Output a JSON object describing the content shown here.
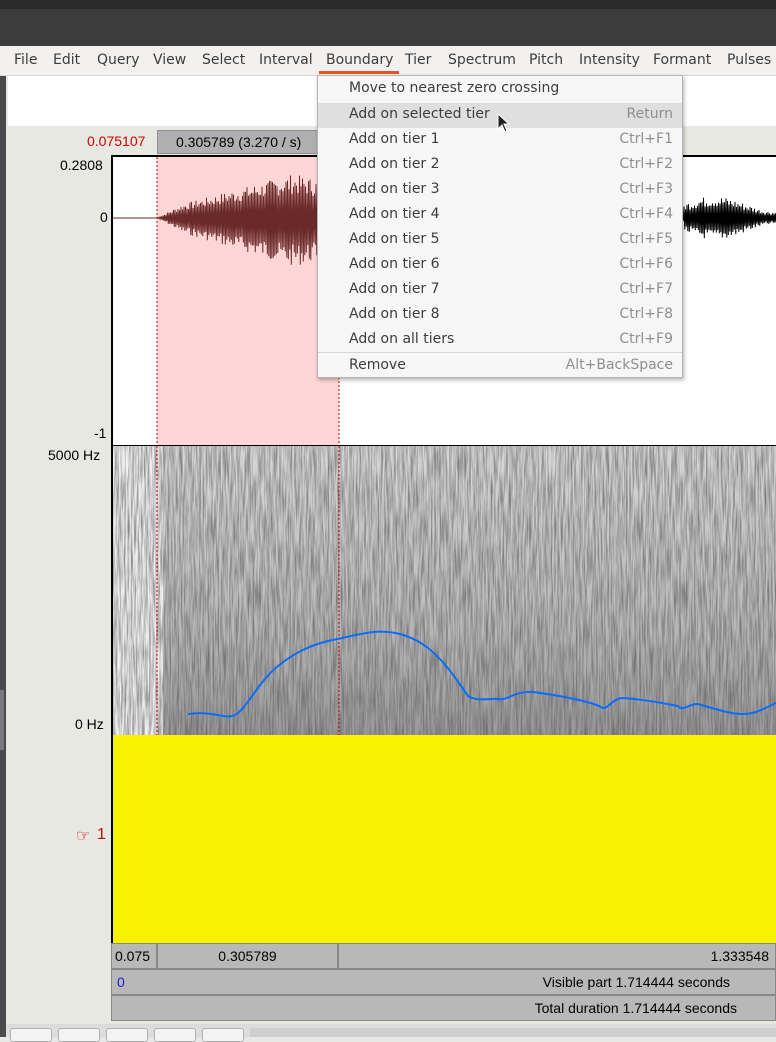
{
  "window": {
    "title": ""
  },
  "menubar": {
    "items": [
      "File",
      "Edit",
      "Query",
      "View",
      "Select",
      "Interval",
      "Boundary",
      "Tier",
      "Spectrum",
      "Pitch",
      "Intensity",
      "Formant",
      "Pulses"
    ],
    "active": "Boundary"
  },
  "boundary_menu": {
    "items": [
      {
        "label": "Move to nearest zero crossing",
        "accel": ""
      },
      {
        "label": "Add on selected tier",
        "accel": "Return"
      },
      {
        "label": "Add on tier 1",
        "accel": "Ctrl+F1"
      },
      {
        "label": "Add on tier 2",
        "accel": "Ctrl+F2"
      },
      {
        "label": "Add on tier 3",
        "accel": "Ctrl+F3"
      },
      {
        "label": "Add on tier 4",
        "accel": "Ctrl+F4"
      },
      {
        "label": "Add on tier 5",
        "accel": "Ctrl+F5"
      },
      {
        "label": "Add on tier 6",
        "accel": "Ctrl+F6"
      },
      {
        "label": "Add on tier 7",
        "accel": "Ctrl+F7"
      },
      {
        "label": "Add on tier 8",
        "accel": "Ctrl+F8"
      },
      {
        "label": "Add on all tiers",
        "accel": "Ctrl+F9"
      },
      {
        "label": "Remove",
        "accel": "Alt+BackSpace"
      }
    ],
    "highlighted": "Add on selected tier"
  },
  "editor": {
    "cursor_time": "0.075107",
    "selection_duration": "0.305789 (3.270 / s)",
    "wave_max": "0.2808",
    "wave_zero": "0",
    "wave_min": "-1",
    "spec_max": "5000 Hz",
    "spec_min": "0 Hz",
    "tier_number": "1",
    "tier_hand": "☞",
    "bar_left": "0.075",
    "bar_selection": "0.305789",
    "bar_right": "1.333548",
    "visible_start": "0",
    "visible_part": "Visible part 1.714444 seconds",
    "total_duration": "Total duration 1.714444 seconds"
  },
  "colors": {
    "selection": "#ffd6d6",
    "tier_fill": "#f7f200",
    "pitch": "#0a6cff",
    "accent": "#e95420",
    "cursor_red": "#d00000"
  }
}
